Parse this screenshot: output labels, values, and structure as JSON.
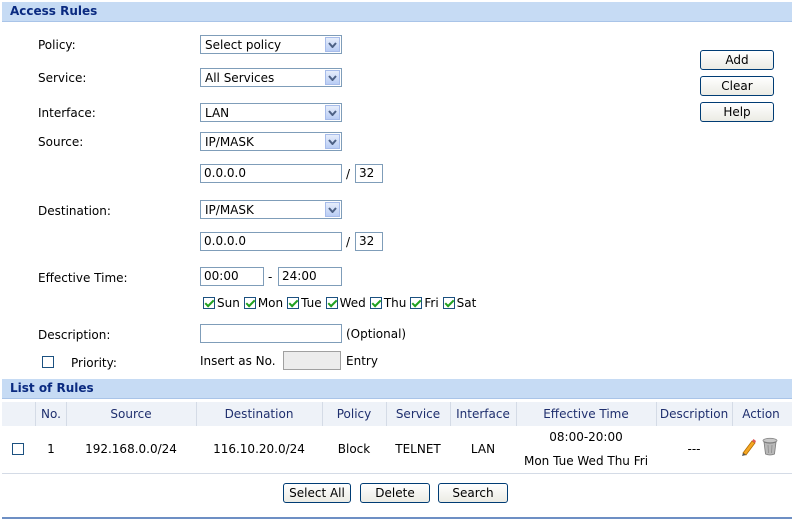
{
  "header": {
    "title": "Access Rules"
  },
  "form": {
    "policy_label": "Policy:",
    "policy_value": "Select policy",
    "service_label": "Service:",
    "service_value": "All Services",
    "interface_label": "Interface:",
    "interface_value": "LAN",
    "source_label": "Source:",
    "source_type": "IP/MASK",
    "source_ip": "0.0.0.0",
    "source_mask": "32",
    "destination_label": "Destination:",
    "destination_type": "IP/MASK",
    "destination_ip": "0.0.0.0",
    "destination_mask": "32",
    "slash": "/",
    "effective_time_label": "Effective Time:",
    "time_start": "00:00",
    "time_dash": "-",
    "time_end": "24:00",
    "days": [
      {
        "label": "Sun",
        "checked": true
      },
      {
        "label": "Mon",
        "checked": true
      },
      {
        "label": "Tue",
        "checked": true
      },
      {
        "label": "Wed",
        "checked": true
      },
      {
        "label": "Thu",
        "checked": true
      },
      {
        "label": "Fri",
        "checked": true
      },
      {
        "label": "Sat",
        "checked": true
      }
    ],
    "description_label": "Description:",
    "description_value": "",
    "optional_text": "(Optional)",
    "priority_label": "Priority:",
    "insert_as_text": "Insert as No.",
    "entry_text": "Entry"
  },
  "buttons": {
    "add": "Add",
    "clear": "Clear",
    "help": "Help"
  },
  "list": {
    "title": "List of Rules",
    "columns": [
      "No.",
      "Source",
      "Destination",
      "Policy",
      "Service",
      "Interface",
      "Effective Time",
      "Description",
      "Action"
    ],
    "rows": [
      {
        "no": "1",
        "source": "192.168.0.0/24",
        "destination": "116.10.20.0/24",
        "policy": "Block",
        "service": "TELNET",
        "interface": "LAN",
        "time": "08:00-20:00",
        "days": "Mon Tue Wed Thu Fri",
        "description": "---",
        "actions": [
          "pencil-icon",
          "trash-icon"
        ]
      }
    ]
  },
  "footer_buttons": {
    "select_all": "Select All",
    "delete": "Delete",
    "search": "Search"
  },
  "colors": {
    "header_bg": "#c6dbf4",
    "header_text": "#0a2a80",
    "accent_border": "#003c74"
  }
}
